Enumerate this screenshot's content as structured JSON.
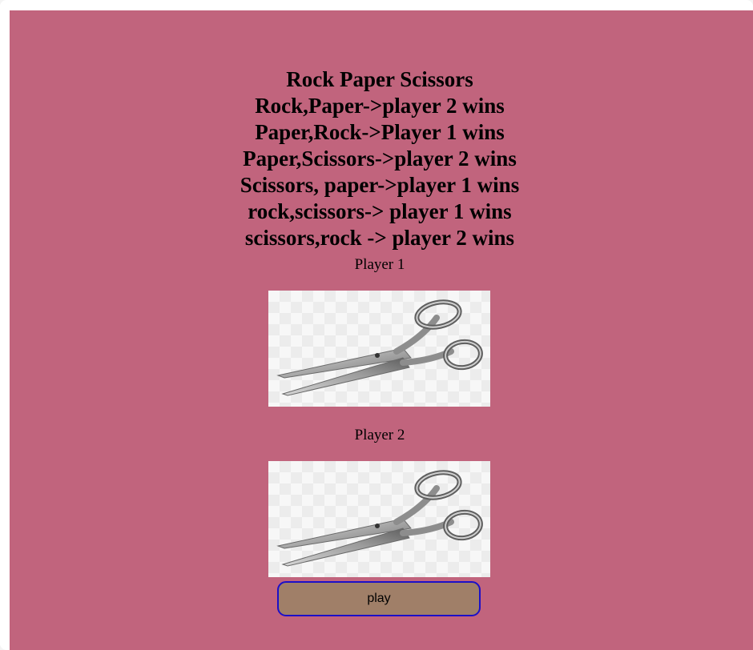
{
  "header": {
    "title": "Rock Paper Scissors",
    "rules": [
      "Rock,Paper->player 2 wins",
      "Paper,Rock->Player 1 wins",
      "Paper,Scissors->player 2 wins",
      "Scissors, paper->player 1 wins",
      "rock,scissors-> player 1 wins",
      "scissors,rock -> player 2 wins"
    ]
  },
  "player1": {
    "label": "Player 1",
    "choice_icon": "scissors-icon"
  },
  "player2": {
    "label": "Player 2",
    "choice_icon": "scissors-icon"
  },
  "play_button": {
    "label": "play"
  },
  "colors": {
    "background": "#c1647d",
    "button_fill": "#a07f68",
    "button_border": "#1c0fc8"
  }
}
